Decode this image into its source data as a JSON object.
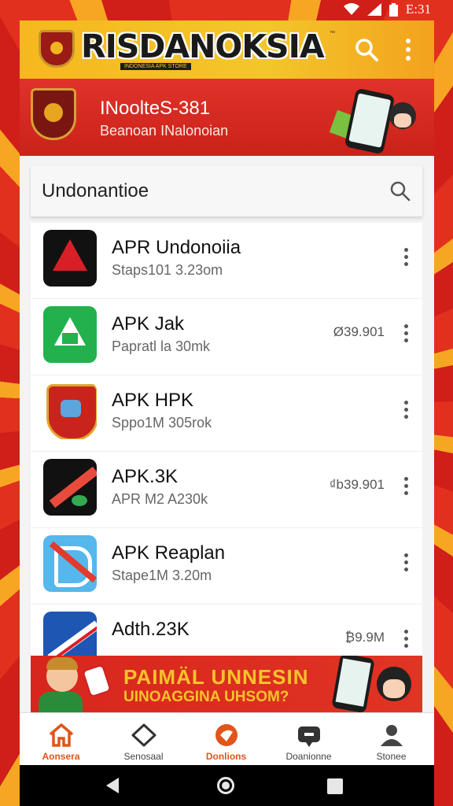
{
  "status_bar": {
    "time": "E:31",
    "icons": [
      "wifi-icon",
      "signal-icon",
      "battery-icon"
    ]
  },
  "header": {
    "title": "RISDANOKSIA",
    "trademark": "™",
    "subtitle": "INDONESIA APK STORE",
    "icons": [
      "search-icon",
      "more-vertical-icon"
    ]
  },
  "banner": {
    "title": "INoolteS-381",
    "subtitle": "Beanoan INalonoian"
  },
  "search": {
    "text": "Undonantioe",
    "icon": "search-icon"
  },
  "apps": [
    {
      "name": "APR Undonoiia",
      "meta": "Staps101 3.23om",
      "price": "",
      "icon": "app-icon-red-a"
    },
    {
      "name": "APK Jak",
      "meta": "Papratl la 30mk",
      "price": "Ø39.901",
      "icon": "app-icon-green-a"
    },
    {
      "name": "APK HPK",
      "meta": "Sppo1M 305rok",
      "price": "",
      "icon": "app-icon-shield"
    },
    {
      "name": "APK.3K",
      "meta": "APR M2 A230k",
      "price": "₫b39.901",
      "icon": "app-icon-black-stripe"
    },
    {
      "name": "APK Reaplan",
      "meta": "Stape1M 3.20m",
      "price": "",
      "icon": "app-icon-blue-a"
    },
    {
      "name": "Adth.23K",
      "meta": "",
      "price": "₿9.9M",
      "icon": "app-icon-blue-stripe"
    }
  ],
  "promo": {
    "line1": "PAIMÄL UNNESIN",
    "line2": "UINOAGGINA UHSOM?"
  },
  "bottom_nav": [
    {
      "label": "Aonsera",
      "icon": "home-icon"
    },
    {
      "label": "Senosaal",
      "icon": "tag-icon"
    },
    {
      "label": "Donlions",
      "icon": "download-icon"
    },
    {
      "label": "Doanionne",
      "icon": "chat-icon"
    },
    {
      "label": "Stonee",
      "icon": "profile-icon"
    }
  ],
  "colors": {
    "accent": "#e1541a",
    "header_yellow": "#f3c62a",
    "banner_red": "#d8261c"
  }
}
